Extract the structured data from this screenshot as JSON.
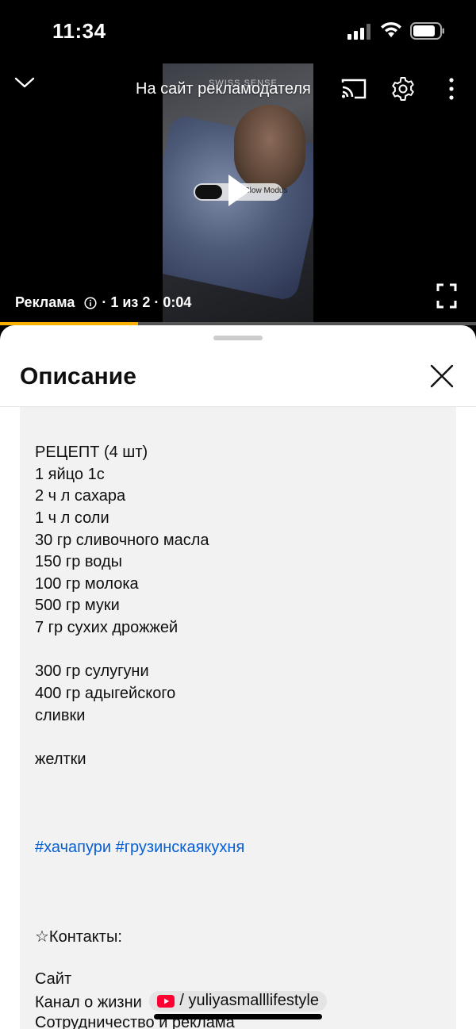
{
  "status_bar": {
    "time": "11:34"
  },
  "player": {
    "brand_overlay": "SWISS SENSE",
    "pill_label": "Slow Modus",
    "advertiser_link": "На сайт рекламодателя",
    "ad_label": "Реклама",
    "ad_position": "· 1 из 2 · 0:04",
    "progress": 0.29,
    "colors": {
      "progress": "#f6b100",
      "track": "#555555"
    }
  },
  "sheet": {
    "title": "Описание",
    "description": {
      "recipe_title": "РЕЦЕПТ (4 шт)",
      "dough": [
        "1 яйцо 1с",
        "2 ч л сахара",
        "1 ч л соли",
        "30 гр сливочного масла",
        "150 гр воды",
        "100 гр молока",
        "500 гр муки",
        "7 гр сухих дрожжей"
      ],
      "filling": [
        "300 гр сулугуни",
        "400 гр адыгейского",
        "сливки"
      ],
      "topping": "желтки",
      "hashtags": "#хачапури #грузинскаякухня",
      "contacts_header": "☆Контакты:",
      "site_label": "Сайт",
      "channel_label": "Канал о жизни",
      "channel_handle": "/ yuliyasmalllifestyle",
      "cooperation_label": "Сотрудничество и реклама"
    },
    "colors": {
      "hashtag": "#065fd4",
      "box": "#f2f2f2"
    }
  },
  "icons": [
    "collapse-icon",
    "cast-icon",
    "settings-icon",
    "more-icon",
    "play-icon",
    "info-icon",
    "fullscreen-icon",
    "close-icon",
    "youtube-icon"
  ]
}
